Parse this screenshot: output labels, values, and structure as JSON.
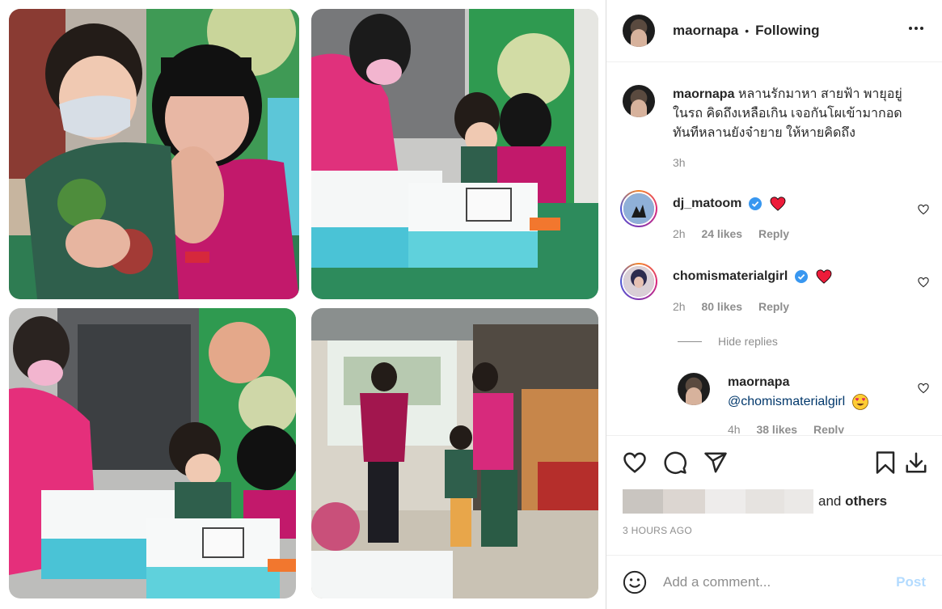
{
  "header": {
    "username": "maornapa",
    "separator": "•",
    "follow_status": "Following",
    "more_icon": "more-horizontal-icon"
  },
  "caption": {
    "username": "maornapa",
    "text": "หลานรักมาหา สายฟ้า พายุอยู่ในรถ คิดถึงเหลือเกิน เจอกันโผเข้ามากอดทันทีหลานยังจ๋ายาย ให้หายคิดถึง",
    "time": "3h"
  },
  "comments": [
    {
      "username": "dj_matoom",
      "verified": true,
      "emoji": "red-heart",
      "time": "2h",
      "likes": "24 likes",
      "reply": "Reply"
    },
    {
      "username": "chomismaterialgirl",
      "verified": true,
      "emoji": "red-heart",
      "time": "2h",
      "likes": "80 likes",
      "reply": "Reply"
    }
  ],
  "hide_replies": "Hide replies",
  "reply": {
    "username": "maornapa",
    "mention": "@chomismaterialgirl",
    "emoji": "heart-eyes",
    "time": "4h",
    "likes": "38 likes",
    "reply": "Reply"
  },
  "actions": {
    "like_icon": "heart-outline-icon",
    "comment_icon": "comment-icon",
    "share_icon": "send-icon",
    "save_icon": "bookmark-icon",
    "download_icon": "download-icon"
  },
  "likes": {
    "and": "and",
    "others": "others"
  },
  "timestamp": "3 HOURS AGO",
  "composer": {
    "placeholder": "Add a comment...",
    "post_label": "Post"
  },
  "colors": {
    "verified": "#3897f0",
    "heart": "#ed4956",
    "post_disabled": "#b3dbff",
    "muted": "#8e8e8e"
  }
}
